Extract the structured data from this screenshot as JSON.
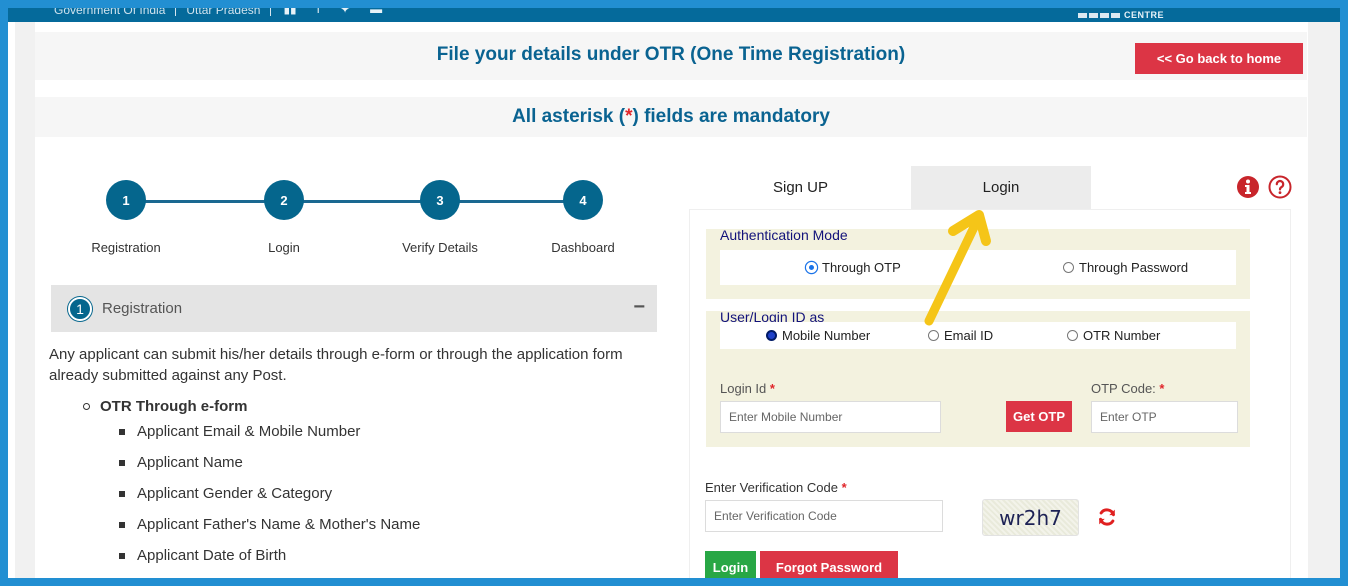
{
  "gov_bar": {
    "items": [
      "Government Of India",
      "Uttar Pradesh"
    ],
    "social_icons": [
      "youtube-icon",
      "facebook-icon",
      "twitter-icon",
      "email-icon"
    ],
    "logo_text": "CENTRE"
  },
  "header": {
    "title": "File your details under OTR (One Time Registration)",
    "back_button": "<< Go back to home"
  },
  "notice": {
    "prefix": "All asterisk (",
    "star": "*",
    "suffix": ") fields are mandatory"
  },
  "stepper": {
    "steps": [
      {
        "number": "1",
        "label": "Registration"
      },
      {
        "number": "2",
        "label": "Login"
      },
      {
        "number": "3",
        "label": "Verify Details"
      },
      {
        "number": "4",
        "label": "Dashboard"
      }
    ]
  },
  "accordion": {
    "number": "1",
    "title": "Registration",
    "toggle": "−",
    "description": "Any applicant can submit his/her details through e-form or through the application form already submitted against any Post.",
    "sub_title": "OTR Through e-form",
    "items": [
      "Applicant Email & Mobile Number",
      "Applicant Name",
      "Applicant Gender & Category",
      "Applicant Father's Name & Mother's Name",
      "Applicant Date of Birth"
    ]
  },
  "tabs": {
    "signup": "Sign UP",
    "login": "Login",
    "active": "Login"
  },
  "auth_mode": {
    "legend": "Authentication Mode",
    "options": [
      "Through OTP",
      "Through Password"
    ],
    "selected": "Through OTP"
  },
  "login_id_as": {
    "legend": "User/Login ID as",
    "options": [
      "Mobile Number",
      "Email ID",
      "OTR Number"
    ],
    "selected": "Mobile Number"
  },
  "login_form": {
    "login_id_label": "Login Id",
    "login_id_placeholder": "Enter Mobile Number",
    "login_id_value": "",
    "otp_label": "OTP Code:",
    "otp_placeholder": "Enter OTP",
    "otp_value": "",
    "get_otp_button": "Get OTP",
    "required_mark": "*",
    "verification_label": "Enter Verification Code",
    "verification_placeholder": "Enter Verification Code",
    "verification_value": "",
    "captcha_text": "wr2h7",
    "login_button": "Login",
    "forgot_button": "Forgot Password"
  },
  "colors": {
    "primary_blue": "#05668d",
    "danger_red": "#dc3545",
    "success_green": "#28a745",
    "annotation_arrow": "#f5c518",
    "frame_blue": "#228fd2"
  }
}
